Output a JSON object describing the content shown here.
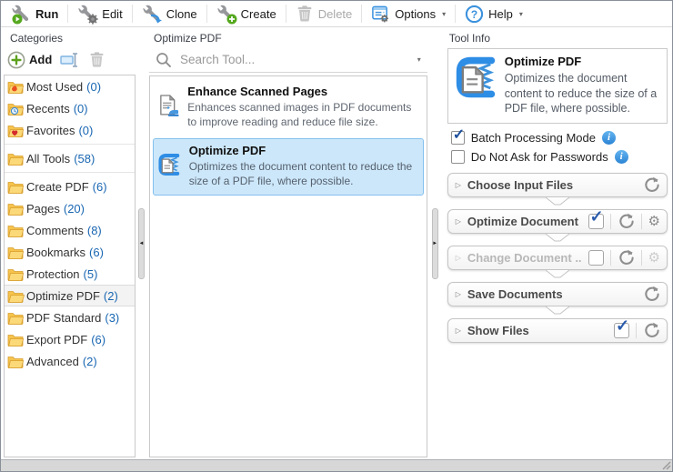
{
  "toolbar": {
    "run": "Run",
    "edit": "Edit",
    "clone": "Clone",
    "create": "Create",
    "delete": "Delete",
    "options": "Options",
    "help": "Help"
  },
  "categories": {
    "title": "Categories",
    "add_label": "Add",
    "items": [
      {
        "label": "Most Used",
        "count": "(0)"
      },
      {
        "label": "Recents",
        "count": "(0)"
      },
      {
        "label": "Favorites",
        "count": "(0)"
      },
      {
        "label": "All Tools",
        "count": "(58)"
      },
      {
        "label": "Create PDF",
        "count": "(6)"
      },
      {
        "label": "Pages",
        "count": "(20)"
      },
      {
        "label": "Comments",
        "count": "(8)"
      },
      {
        "label": "Bookmarks",
        "count": "(6)"
      },
      {
        "label": "Protection",
        "count": "(5)"
      },
      {
        "label": "Optimize PDF",
        "count": "(2)"
      },
      {
        "label": "PDF Standard",
        "count": "(3)"
      },
      {
        "label": "Export PDF",
        "count": "(6)"
      },
      {
        "label": "Advanced",
        "count": "(2)"
      }
    ],
    "selected_item": "Optimize PDF"
  },
  "tools": {
    "title": "Optimize PDF",
    "search_placeholder": "Search Tool...",
    "items": [
      {
        "title": "Enhance Scanned Pages",
        "description": "Enhances scanned images in PDF documents to improve reading and reduce file size."
      },
      {
        "title": "Optimize PDF",
        "description": "Optimizes the document content to reduce the size of a PDF file, where possible."
      }
    ],
    "selected_item": "Optimize PDF"
  },
  "tool_info": {
    "title": "Tool Info",
    "tool_title": "Optimize PDF",
    "tool_description": "Optimizes the document content to reduce the size of a PDF file, where possible.",
    "options": [
      {
        "label": "Batch Processing Mode",
        "checked": true
      },
      {
        "label": "Do Not Ask for Passwords",
        "checked": false
      }
    ],
    "sections": [
      {
        "label": "Choose Input Files",
        "checkbox": null,
        "reset": true,
        "gear": false,
        "disabled": false
      },
      {
        "label": "Optimize Document",
        "checkbox": true,
        "reset": true,
        "gear": true,
        "disabled": false
      },
      {
        "label": "Change Document ..",
        "checkbox": false,
        "reset": true,
        "gear": true,
        "disabled": true
      },
      {
        "label": "Save Documents",
        "checkbox": null,
        "reset": true,
        "gear": false,
        "disabled": false
      },
      {
        "label": "Show Files",
        "checkbox": true,
        "reset": true,
        "gear": false,
        "disabled": false
      }
    ]
  },
  "icons": {
    "expand_chevron": "▷",
    "dropdown_caret": "▾",
    "collapse_left": "◄",
    "collapse_right": "►",
    "gear": "⚙",
    "check": "✓",
    "info": "i"
  },
  "colors": {
    "accent_blue": "#2e8de5",
    "selection_bg": "#cde7fa",
    "selection_border": "#84c0ed",
    "count_blue": "#1866b2",
    "run_green": "#55a81e"
  }
}
